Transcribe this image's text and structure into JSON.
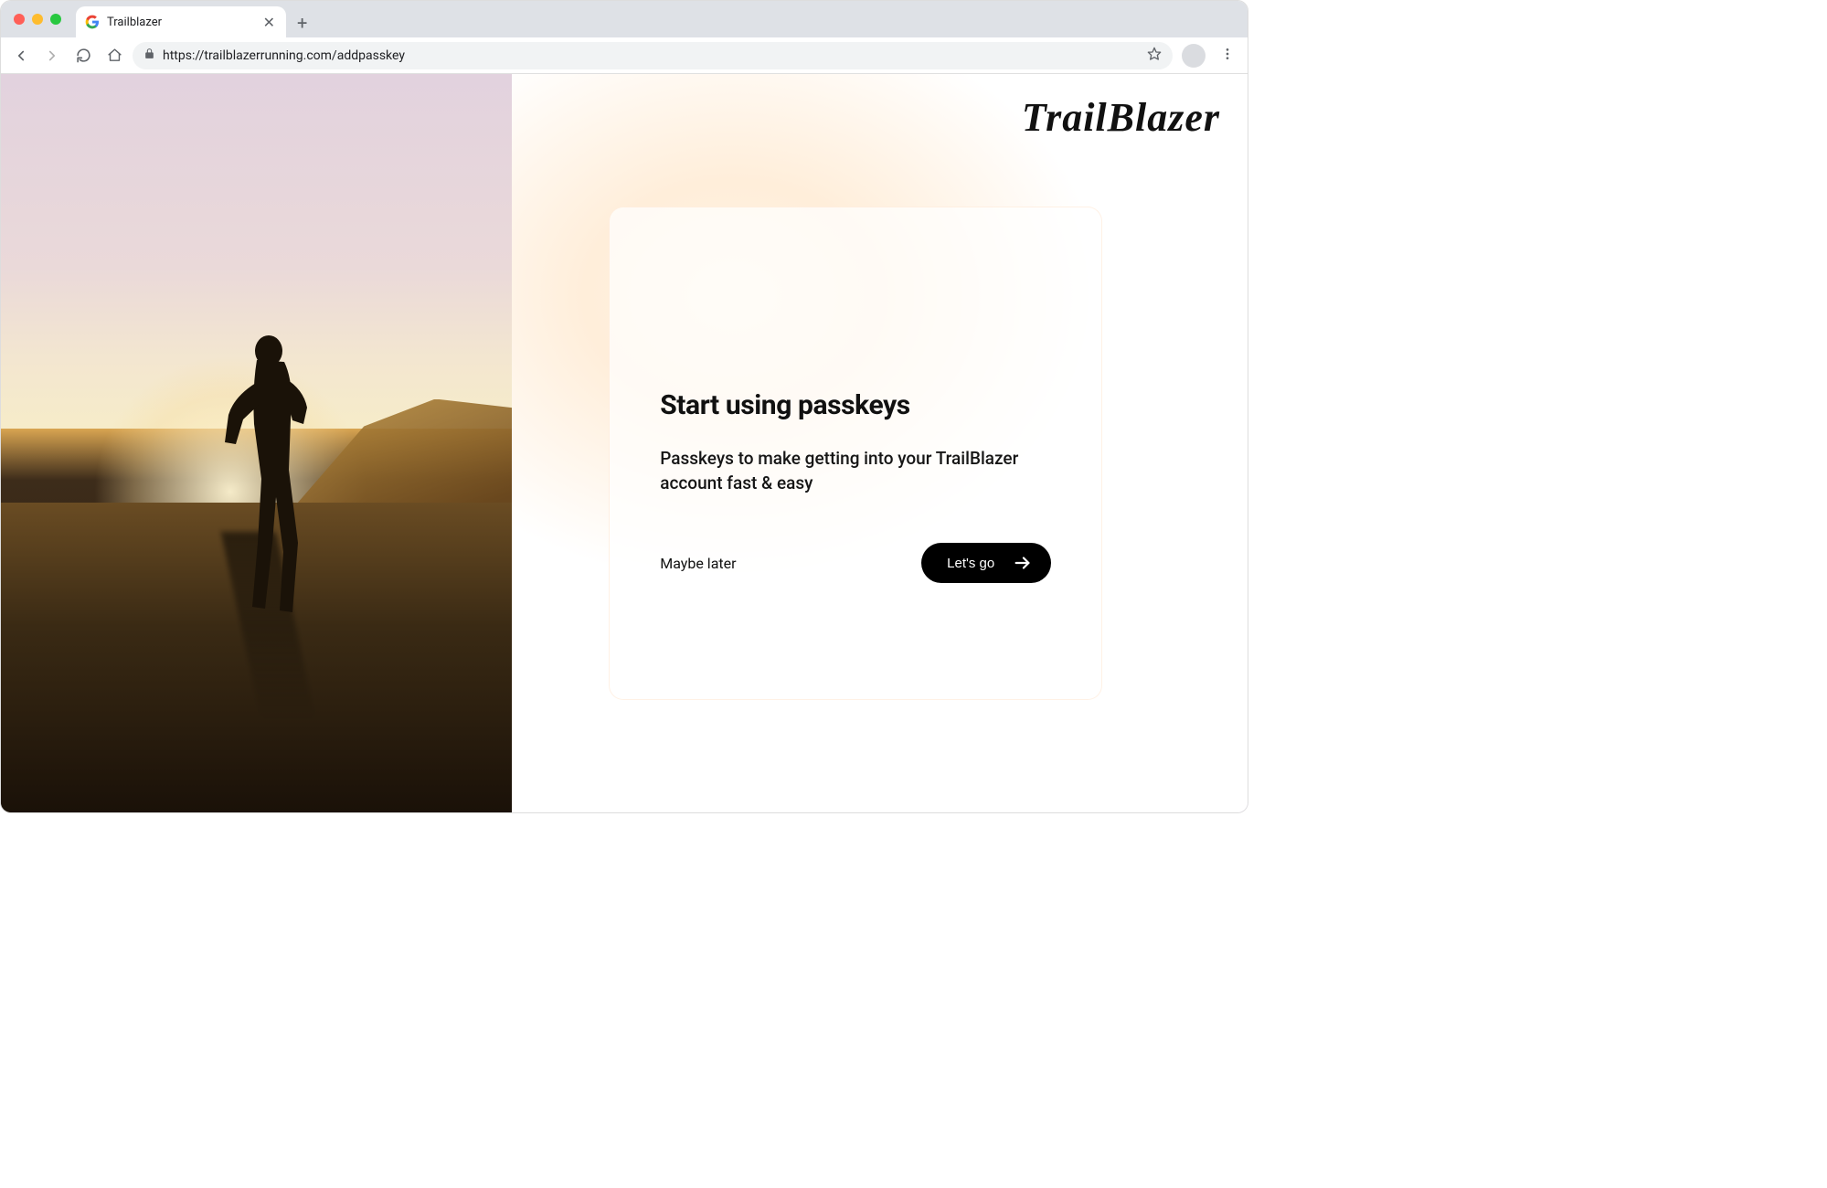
{
  "browser": {
    "tab_title": "Trailblazer",
    "url": "https://trailblazerrunning.com/addpasskey"
  },
  "brand": "TrailBlazer",
  "card": {
    "heading": "Start using passkeys",
    "body": "Passkeys to make getting into your TrailBlazer account fast & easy",
    "secondary_action": "Maybe later",
    "primary_action": "Let's go"
  }
}
